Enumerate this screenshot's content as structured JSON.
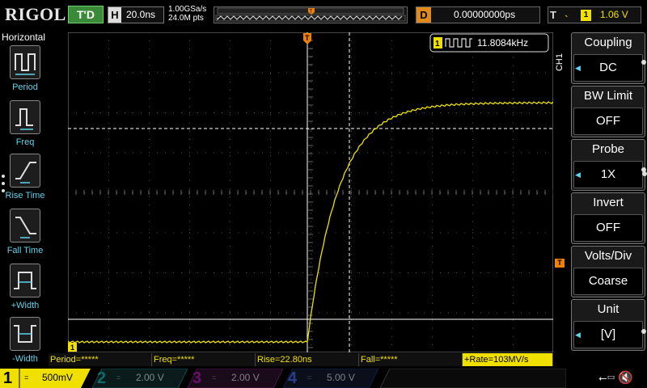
{
  "top": {
    "logo": "RIGOL",
    "run_status": "T'D",
    "horizontal_letter": "H",
    "timebase": "20.0ns",
    "sample_rate": "1.00GSa/s",
    "mem_depth": "24.0M pts",
    "delay_letter": "D",
    "delay": "0.00000000ps",
    "trigger_letter": "T",
    "trigger_edge": "rising",
    "trigger_source": "1",
    "trigger_level": "1.06 V"
  },
  "left_menu": {
    "title": "Horizontal",
    "items": [
      {
        "label": "Period",
        "icon": "period-icon"
      },
      {
        "label": "Freq",
        "icon": "freq-icon"
      },
      {
        "label": "Rise Time",
        "icon": "rise-time-icon"
      },
      {
        "label": "Fall Time",
        "icon": "fall-time-icon"
      },
      {
        "label": "+Width",
        "icon": "positive-width-icon"
      },
      {
        "label": "-Width",
        "icon": "negative-width-icon"
      }
    ]
  },
  "screen": {
    "freq_badge_channel": "1",
    "freq_badge_value": "11.8084kHz",
    "trigger_marker": "T",
    "channel_ground_marker": "1",
    "trigger_level_marker": "T"
  },
  "measurements": [
    {
      "label": "Period=*****",
      "selected": false
    },
    {
      "label": "Freq=*****",
      "selected": false
    },
    {
      "label": "Rise=22.80ns",
      "selected": false
    },
    {
      "label": "Fall=*****",
      "selected": false
    },
    {
      "label": "+Rate=103MV/s",
      "selected": true
    }
  ],
  "right_menu": {
    "channel_label": "CH1",
    "buttons": [
      {
        "title": "Coupling",
        "value": "DC"
      },
      {
        "title": "BW Limit",
        "value": "OFF"
      },
      {
        "title": "Probe",
        "value": "1X"
      },
      {
        "title": "Invert",
        "value": "OFF"
      },
      {
        "title": "Volts/Div",
        "value": "Coarse"
      },
      {
        "title": "Unit",
        "value": "[V]"
      }
    ]
  },
  "channels": [
    {
      "num": "1",
      "coupling": "=",
      "scale": "500mV",
      "color": "#f0e000",
      "active": true
    },
    {
      "num": "2",
      "coupling": "=",
      "scale": "2.00 V",
      "color": "#00c8c8",
      "active": false
    },
    {
      "num": "3",
      "coupling": "=",
      "scale": "2.00 V",
      "color": "#c800c8",
      "active": false
    },
    {
      "num": "4",
      "coupling": "=",
      "scale": "5.00 V",
      "color": "#3c64ff",
      "active": false
    }
  ],
  "colors": {
    "ch1": "#f0e000",
    "trigger": "#f08000",
    "menu_accent": "#5fd3ea"
  }
}
